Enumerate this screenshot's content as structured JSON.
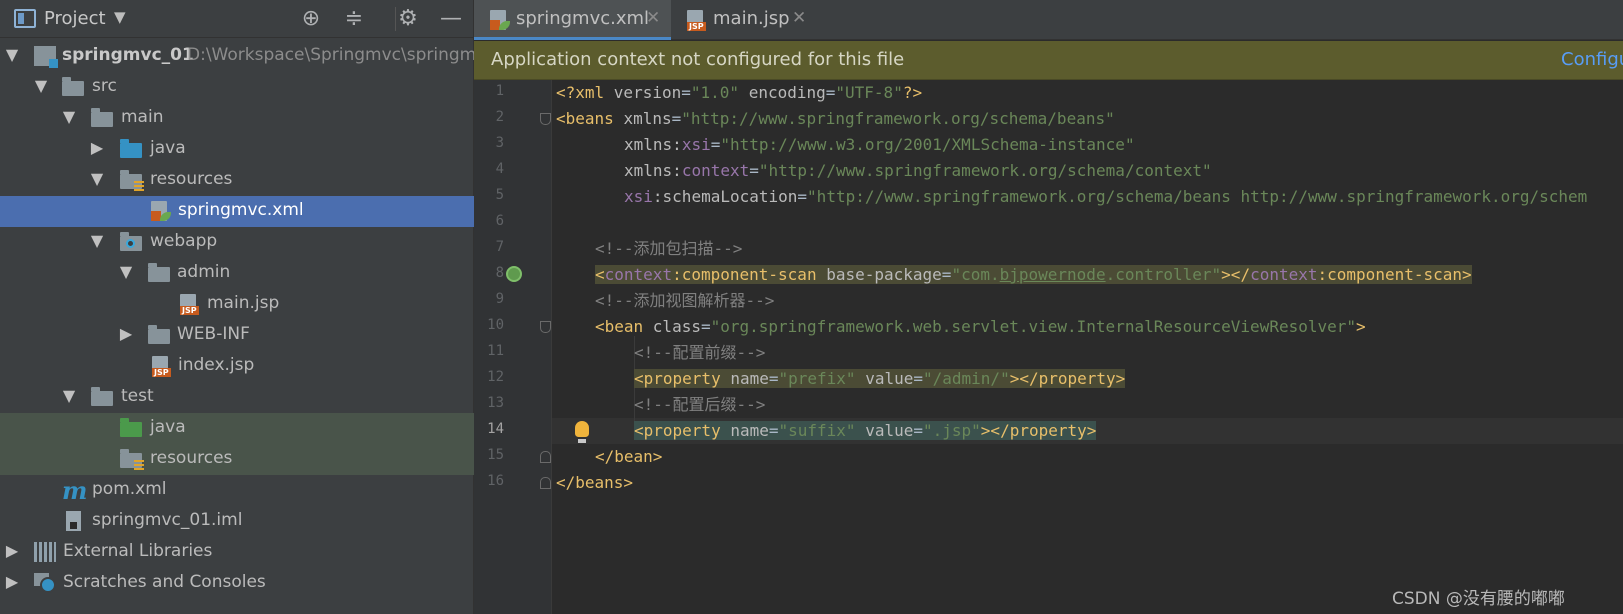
{
  "project_panel": {
    "title": "Project",
    "tree": [
      {
        "label": "springmvc_01",
        "path": "D:\\Workspace\\Springmvc\\springmv"
      },
      {
        "label": "src"
      },
      {
        "label": "main"
      },
      {
        "label": "java"
      },
      {
        "label": "resources"
      },
      {
        "label": "springmvc.xml"
      },
      {
        "label": "webapp"
      },
      {
        "label": "admin"
      },
      {
        "label": "main.jsp"
      },
      {
        "label": "WEB-INF"
      },
      {
        "label": "index.jsp"
      },
      {
        "label": "test"
      },
      {
        "label": "java"
      },
      {
        "label": "resources"
      },
      {
        "label": "pom.xml"
      },
      {
        "label": "springmvc_01.iml"
      },
      {
        "label": "External Libraries"
      },
      {
        "label": "Scratches and Consoles"
      }
    ]
  },
  "editor": {
    "tabs": [
      {
        "label": "springmvc.xml",
        "close": "✕"
      },
      {
        "label": "main.jsp",
        "close": "✕"
      }
    ],
    "banner": {
      "message": "Application context not configured for this file",
      "action": "Configu"
    },
    "line_numbers": [
      "1",
      "2",
      "3",
      "4",
      "5",
      "6",
      "7",
      "8",
      "9",
      "10",
      "11",
      "12",
      "13",
      "14",
      "15",
      "16"
    ],
    "current_line": "14",
    "code": {
      "l1": {
        "a": "<?xml ",
        "b": "version",
        "c": "=",
        "d": "\"1.0\"",
        "e": " ",
        "f": "encoding",
        "g": "=",
        "h": "\"UTF-8\"",
        "i": "?>"
      },
      "l2": {
        "a": "<beans ",
        "b": "xmlns",
        "c": "=",
        "d": "\"http://www.springframework.org/schema/beans\""
      },
      "l3": {
        "a": "xmlns",
        "b": ":",
        "c": "xsi",
        "d": "=",
        "e": "\"http://www.w3.org/2001/XMLSchema-instance\""
      },
      "l4": {
        "a": "xmlns",
        "b": ":",
        "c": "context",
        "d": "=",
        "e": "\"http://www.springframework.org/schema/context\""
      },
      "l5": {
        "a": "xsi",
        "b": ":schemaLocation",
        "c": "=",
        "d": "\"http://www.springframework.org/schema/beans http://www.springframework.org/schem"
      },
      "l7": "<!--添加包扫描-->",
      "l8": {
        "a": "<",
        "b": "context",
        "c": ":component-scan ",
        "d": "base-package",
        "e": "=",
        "f": "\"com.",
        "g": "bjpowernode",
        "h": ".controller\"",
        "i": "></",
        "j": "context",
        "k": ":component-scan>"
      },
      "l9": "<!--添加视图解析器-->",
      "l10": {
        "a": "<bean ",
        "b": "class",
        "c": "=",
        "d": "\"org.springframework.web.servlet.view.InternalResourceViewResolver\"",
        "e": ">"
      },
      "l11": "<!--配置前缀-->",
      "l12": {
        "a": "<property ",
        "b": "name",
        "c": "=",
        "d": "\"prefix\"",
        "e": " value",
        "f": "=",
        "g": "\"/admin/\"",
        "h": "></property>"
      },
      "l13": "<!--配置后缀-->",
      "l14": {
        "a": "<property ",
        "b": "name",
        "c": "=",
        "d": "\"suffix\"",
        "e": " value",
        "f": "=",
        "g": "\".jsp\"",
        "h": "></property>"
      },
      "l15": "</bean>",
      "l16": "</beans>"
    }
  },
  "watermark": "CSDN @没有腰的嘟嘟",
  "colors": {
    "selection": "#4b6eaf",
    "banner_bg": "#5c5c2d",
    "xml_tag": "#e8bf6a",
    "xml_string": "#6a8759",
    "xml_namespace": "#9876aa",
    "comment": "#808080"
  }
}
